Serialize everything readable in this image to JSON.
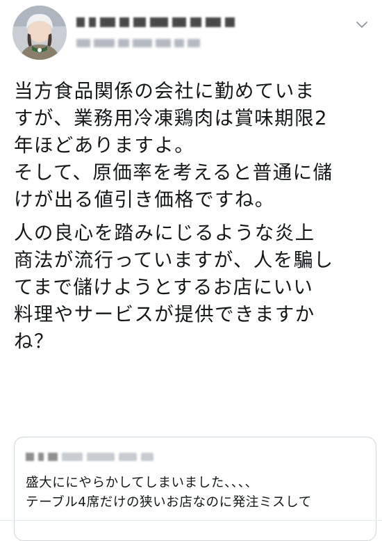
{
  "tweet": {
    "author_name": "",
    "author_handle": "",
    "body_paragraphs": [
      [
        "当方食品関係の会社に勤めていま",
        "すが、業務用冷凍鶏肉は賞味期限2",
        "年ほどありますよ。",
        "そして、原価率を考えると普通に儲",
        "けが出る値引き価格ですね。"
      ],
      [
        "人の良心を踏みにじるような炎上",
        "商法が流行っていますが、人を騙し",
        "てまで儲けようとするお店にいい",
        "料理やサービスが提供できますか",
        "ね？"
      ]
    ]
  },
  "quoted_tweet": {
    "author_name": "",
    "author_handle": "",
    "lines": [
      "盛大ににやらかしてしまいました、、、、",
      "テーブル4席だけの狭いお店なのに発注ミスして"
    ]
  },
  "icons": {
    "menu": "chevron-down-icon",
    "avatar": "profile-avatar"
  },
  "colors": {
    "text": "#14171a",
    "border": "#ccd6dd",
    "muted": "#8899a6"
  }
}
